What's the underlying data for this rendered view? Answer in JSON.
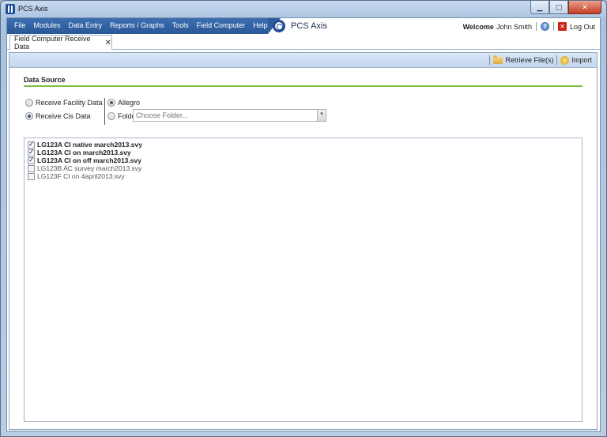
{
  "window": {
    "title": "PCS Axis",
    "controls": {
      "minimize": "▁",
      "maximize": "▢",
      "close": "✕"
    }
  },
  "menu": {
    "items": [
      "File",
      "Modules",
      "Data Entry",
      "Reports / Graphs",
      "Tools",
      "Field Computer",
      "Help"
    ]
  },
  "brand": {
    "name": "PCS Axis"
  },
  "user": {
    "welcome_label": "Welcome",
    "name": "John Smith",
    "logout_label": "Log Out",
    "help_glyph": "?",
    "logout_glyph": "✕"
  },
  "tabs": [
    {
      "label": "Field Computer Receive Data",
      "close_glyph": "✕"
    }
  ],
  "toolbar": {
    "retrieve_label": "Retrieve File(s)",
    "import_label": "Import"
  },
  "data_source": {
    "title": "Data Source",
    "receive_facility": "Receive Facility Data",
    "receive_cis": "Receive Cis Data",
    "allegro": "Allegro",
    "folder": "Folder",
    "folder_placeholder": "Choose Folder...",
    "combo_glyph": "▾"
  },
  "files": [
    {
      "name": "LG123A CI native march2013.svy",
      "checked": true
    },
    {
      "name": "LG123A CI on march2013.svy",
      "checked": true
    },
    {
      "name": "LG123A CI on off march2013.svy",
      "checked": true
    },
    {
      "name": "LG123B AC survey march2013.svy",
      "checked": false
    },
    {
      "name": "LG123F CI on 4april2013.svy",
      "checked": false
    }
  ],
  "colors": {
    "menu_bar": "#2f5e9f",
    "section_rule": "#7dbb42",
    "toolbar": "#c9daef",
    "logout_icon": "#c8261a"
  }
}
